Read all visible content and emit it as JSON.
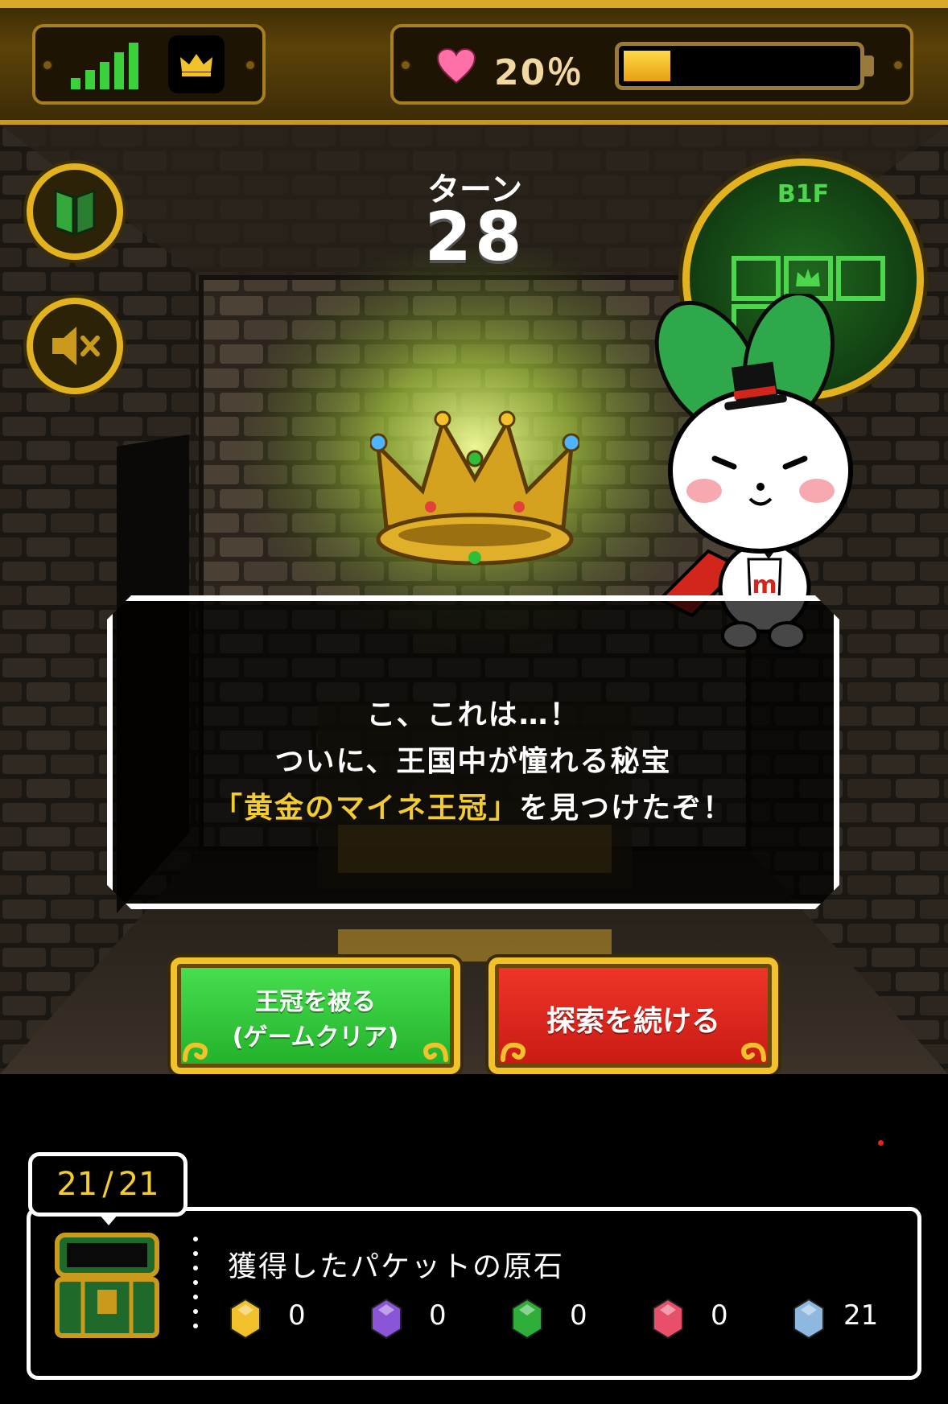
{
  "status_bar": {
    "signal_bars": 5,
    "health_percent_label": "20％",
    "health_fill": 0.2
  },
  "turn": {
    "label": "ターン",
    "value": "28"
  },
  "minimap": {
    "floor": "B1F"
  },
  "dialog": {
    "line1": "こ、これは…！",
    "line2": "ついに、王国中が憧れる秘宝",
    "line3_highlight": "「黄金のマイネ王冠」",
    "line3_rest": "を見つけたぞ！"
  },
  "buttons": {
    "wear_crown_line1": "王冠を被る",
    "wear_crown_line2": "(ゲームクリア)",
    "continue_explore": "探索を続ける"
  },
  "collection": {
    "count": "21",
    "separator": "/",
    "total": "21",
    "title": "獲得したパケットの原石",
    "stones": [
      {
        "color": "#f2c02a",
        "count": "0"
      },
      {
        "color": "#8a55d6",
        "count": "0"
      },
      {
        "color": "#2fae3a",
        "count": "0"
      },
      {
        "color": "#e8506a",
        "count": "0"
      },
      {
        "color": "#8fb8e0",
        "count": "21"
      }
    ]
  },
  "colors": {
    "gold": "#e3b31f",
    "green_button": "#2fc93c",
    "red_button": "#e3241a",
    "highlight_text": "#f3cc2f"
  }
}
